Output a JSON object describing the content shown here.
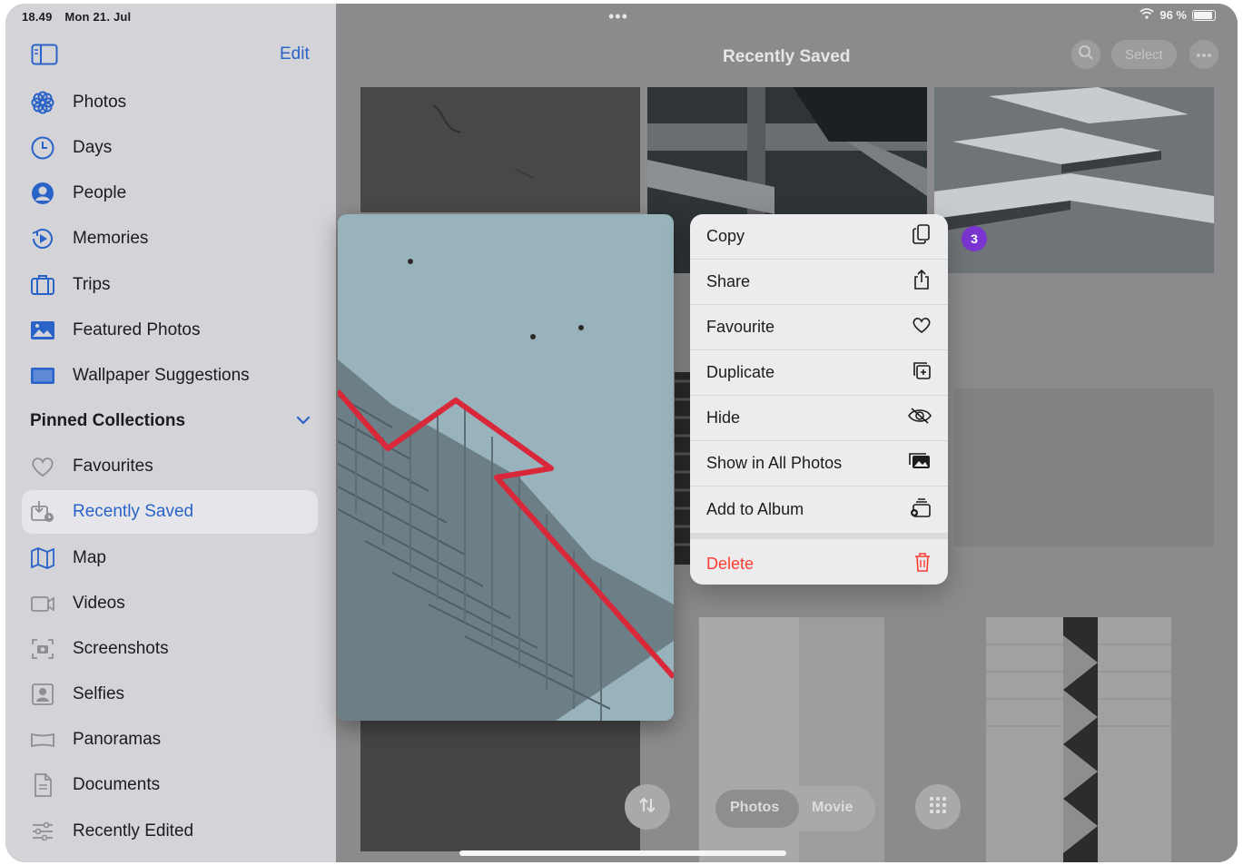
{
  "status": {
    "time": "18.49",
    "date": "Mon 21. Jul",
    "battery": "96 %",
    "dots": "•••"
  },
  "sidebar": {
    "edit_label": "Edit",
    "items": [
      {
        "label": "Photos",
        "icon": "photos-flower-icon"
      },
      {
        "label": "Days",
        "icon": "clock-icon"
      },
      {
        "label": "People",
        "icon": "person-circle-icon"
      },
      {
        "label": "Memories",
        "icon": "memories-play-icon"
      },
      {
        "label": "Trips",
        "icon": "suitcase-icon"
      },
      {
        "label": "Featured Photos",
        "icon": "featured-photo-icon"
      },
      {
        "label": "Wallpaper Suggestions",
        "icon": "wallpaper-icon"
      }
    ],
    "pinned_header": "Pinned Collections",
    "pinned": [
      {
        "label": "Favourites",
        "icon": "heart-icon"
      },
      {
        "label": "Recently Saved",
        "icon": "recently-saved-icon",
        "active": true
      },
      {
        "label": "Map",
        "icon": "map-icon"
      },
      {
        "label": "Videos",
        "icon": "video-icon"
      },
      {
        "label": "Screenshots",
        "icon": "screenshot-icon"
      },
      {
        "label": "Selfies",
        "icon": "selfie-icon"
      },
      {
        "label": "Panoramas",
        "icon": "panorama-icon"
      },
      {
        "label": "Documents",
        "icon": "document-icon"
      },
      {
        "label": "Recently Edited",
        "icon": "sliders-icon"
      }
    ]
  },
  "main": {
    "title": "Recently Saved",
    "select_label": "Select",
    "selection_count": "3"
  },
  "menu": {
    "items": [
      {
        "label": "Copy",
        "icon": "copy-icon"
      },
      {
        "label": "Share",
        "icon": "share-icon"
      },
      {
        "label": "Favourite",
        "icon": "heart-icon"
      },
      {
        "label": "Duplicate",
        "icon": "duplicate-icon"
      },
      {
        "label": "Hide",
        "icon": "eye-slash-icon"
      },
      {
        "label": "Show in All Photos",
        "icon": "photos-stack-icon"
      },
      {
        "label": "Add to Album",
        "icon": "add-album-icon"
      }
    ],
    "delete_label": "Delete"
  },
  "bottom": {
    "seg_photos": "Photos",
    "seg_movie": "Movie"
  },
  "colors": {
    "accent": "#2a63c8",
    "danger": "#ff3b30",
    "badge": "#7a35d0",
    "railing": "#d8283a"
  }
}
